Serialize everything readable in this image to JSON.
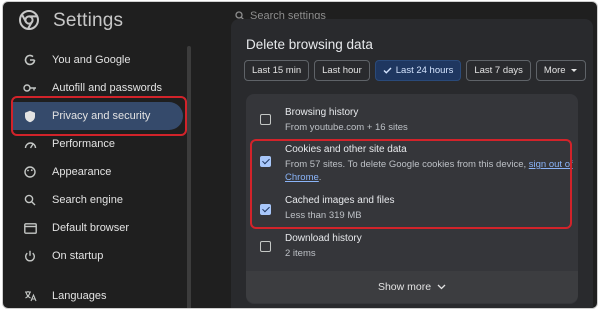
{
  "header": {
    "title": "Settings",
    "search_placeholder": "Search settings"
  },
  "sidebar": {
    "items": [
      {
        "label": "You and Google",
        "icon": "google-icon"
      },
      {
        "label": "Autofill and passwords",
        "icon": "key-icon"
      },
      {
        "label": "Privacy and security",
        "icon": "shield-icon",
        "active": true
      },
      {
        "label": "Performance",
        "icon": "speedometer-icon"
      },
      {
        "label": "Appearance",
        "icon": "palette-icon"
      },
      {
        "label": "Search engine",
        "icon": "search-icon"
      },
      {
        "label": "Default browser",
        "icon": "browser-icon"
      },
      {
        "label": "On startup",
        "icon": "power-icon"
      },
      {
        "label": "Languages",
        "icon": "translate-icon"
      }
    ]
  },
  "dialog": {
    "title": "Delete browsing data",
    "time_ranges": [
      "Last 15 min",
      "Last hour",
      "Last 24 hours",
      "Last 7 days",
      "More"
    ],
    "selected_range": "Last 24 hours",
    "items": [
      {
        "title": "Browsing history",
        "subtitle": "From youtube.com + 16 sites",
        "checked": false
      },
      {
        "title": "Cookies and other site data",
        "subtitle": "From 57 sites. To delete Google cookies from this device, ",
        "link": "sign out of Chrome",
        "after_link": ".",
        "checked": true
      },
      {
        "title": "Cached images and files",
        "subtitle": "Less than 319 MB",
        "checked": true
      },
      {
        "title": "Download history",
        "subtitle": "2 items",
        "checked": false
      }
    ],
    "show_more": "Show more"
  },
  "colors": {
    "accent": "#a8c7fa",
    "highlight": "#d2232a",
    "active_nav": "#354a6b"
  }
}
